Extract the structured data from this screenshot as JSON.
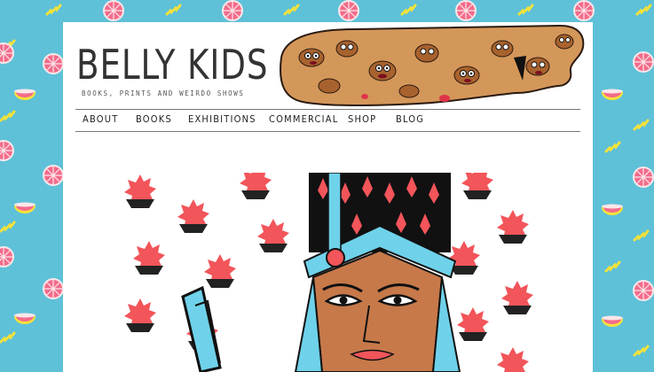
{
  "site": {
    "title": "BELLY KIDS",
    "tagline": "BOOKS, PRINTS AND WEIRDO SHOWS"
  },
  "nav": {
    "items": [
      {
        "label": "ABOUT"
      },
      {
        "label": "BOOKS"
      },
      {
        "label": "EXHIBITIONS"
      },
      {
        "label": "COMMERCIAL"
      },
      {
        "label": "SHOP"
      },
      {
        "label": "BLOG"
      }
    ]
  },
  "colors": {
    "background": "#5ec1d8",
    "grapefruit": "#f46b8a",
    "lemon": "#f5e23a",
    "art_red": "#f2555a",
    "art_blue": "#6fd2ea",
    "art_skin": "#c7794a"
  }
}
